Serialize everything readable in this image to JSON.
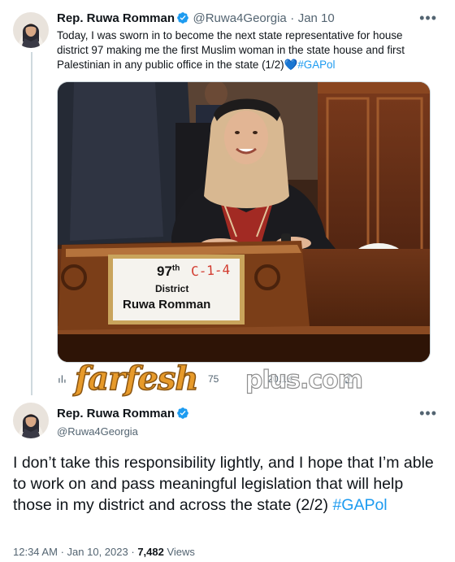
{
  "tweet1": {
    "display_name": "Rep. Ruwa Romman",
    "handle": "@Ruwa4Georgia",
    "separator": "·",
    "date": "Jan 10",
    "text": "Today, I was sworn in to become the next state representative for house district 97 making me the first Muslim woman in the state house and first Palestinian in any public office in the state (1/2)",
    "emoji": "💙",
    "hashtag": "#GAPol",
    "more_label": "•••",
    "photo": {
      "placard_number": "97",
      "placard_suffix": "th",
      "placard_handwritten": "C-1-4",
      "placard_word": "District",
      "placard_name": "Ruwa Romman"
    },
    "actions": {
      "reply_count": "",
      "retweet_count": "75",
      "like_count": "20.1K"
    }
  },
  "watermark": {
    "part1": "farfesh",
    "part2": "plus.com"
  },
  "tweet2": {
    "display_name": "Rep. Ruwa Romman",
    "handle": "@Ruwa4Georgia",
    "more_label": "•••",
    "text": "I don’t take this responsibility lightly, and I hope that I’m able to work on and pass meaningful legislation that will help those in my district and across the state (2/2)",
    "hashtag": "#GAPol",
    "time": "12:34 AM",
    "dot": "·",
    "date": "Jan 10, 2023",
    "views_count": "7,482",
    "views_label": "Views"
  },
  "colors": {
    "link": "#1d9bf0",
    "verified": "#1d9bf0",
    "muted": "#536471"
  }
}
